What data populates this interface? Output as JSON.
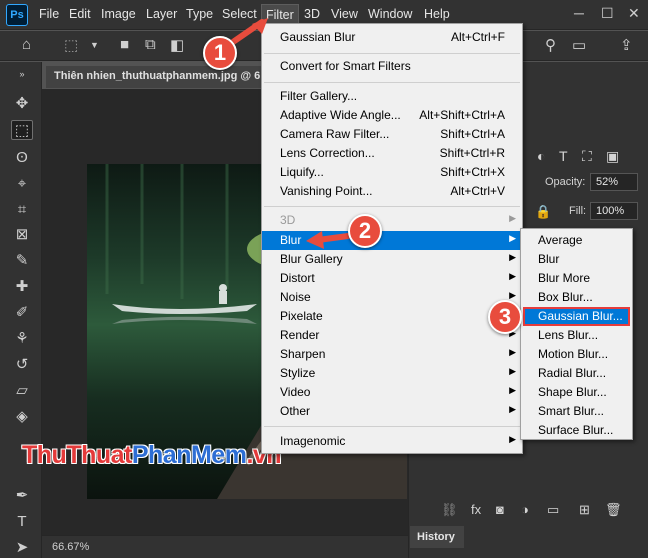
{
  "app": {
    "logo": "Ps"
  },
  "menubar": {
    "items": [
      "File",
      "Edit",
      "Image",
      "Layer",
      "Type",
      "Select",
      "Filter",
      "3D",
      "View",
      "Window",
      "Help"
    ],
    "active": "Filter"
  },
  "document": {
    "tab_title": "Thiên nhien_thuthuatphanmem.jpg @ 6",
    "zoom": "66.67%"
  },
  "panels": {
    "opacity_label": "Opacity:",
    "opacity_value": "52%",
    "fill_label": "Fill:",
    "fill_value": "100%",
    "history_tab": "History"
  },
  "filter_menu": {
    "last_filter": {
      "label": "Gaussian Blur",
      "shortcut": "Alt+Ctrl+F"
    },
    "convert": "Convert for Smart Filters",
    "filter_gallery": "Filter Gallery...",
    "adaptive_wide_angle": {
      "label": "Adaptive Wide Angle...",
      "shortcut": "Alt+Shift+Ctrl+A"
    },
    "camera_raw": {
      "label": "Camera Raw Filter...",
      "shortcut": "Shift+Ctrl+A"
    },
    "lens_correction": {
      "label": "Lens Correction...",
      "shortcut": "Shift+Ctrl+R"
    },
    "liquify": {
      "label": "Liquify...",
      "shortcut": "Shift+Ctrl+X"
    },
    "vanishing_point": {
      "label": "Vanishing Point...",
      "shortcut": "Alt+Ctrl+V"
    },
    "categories": [
      "3D",
      "Blur",
      "Blur Gallery",
      "Distort",
      "Noise",
      "Pixelate",
      "Render",
      "Sharpen",
      "Stylize",
      "Video",
      "Other"
    ],
    "imagenomic": "Imagenomic"
  },
  "blur_submenu": {
    "items": [
      "Average",
      "Blur",
      "Blur More",
      "Box Blur...",
      "Gaussian Blur...",
      "Lens Blur...",
      "Motion Blur...",
      "Radial Blur...",
      "Shape Blur...",
      "Smart Blur...",
      "Surface Blur..."
    ],
    "highlighted": "Gaussian Blur..."
  },
  "annotations": {
    "step1": "1",
    "step2": "2",
    "step3": "3"
  },
  "watermark": {
    "part1": "ThuThuat",
    "part2": "PhanMem",
    "part3": ".vn"
  }
}
